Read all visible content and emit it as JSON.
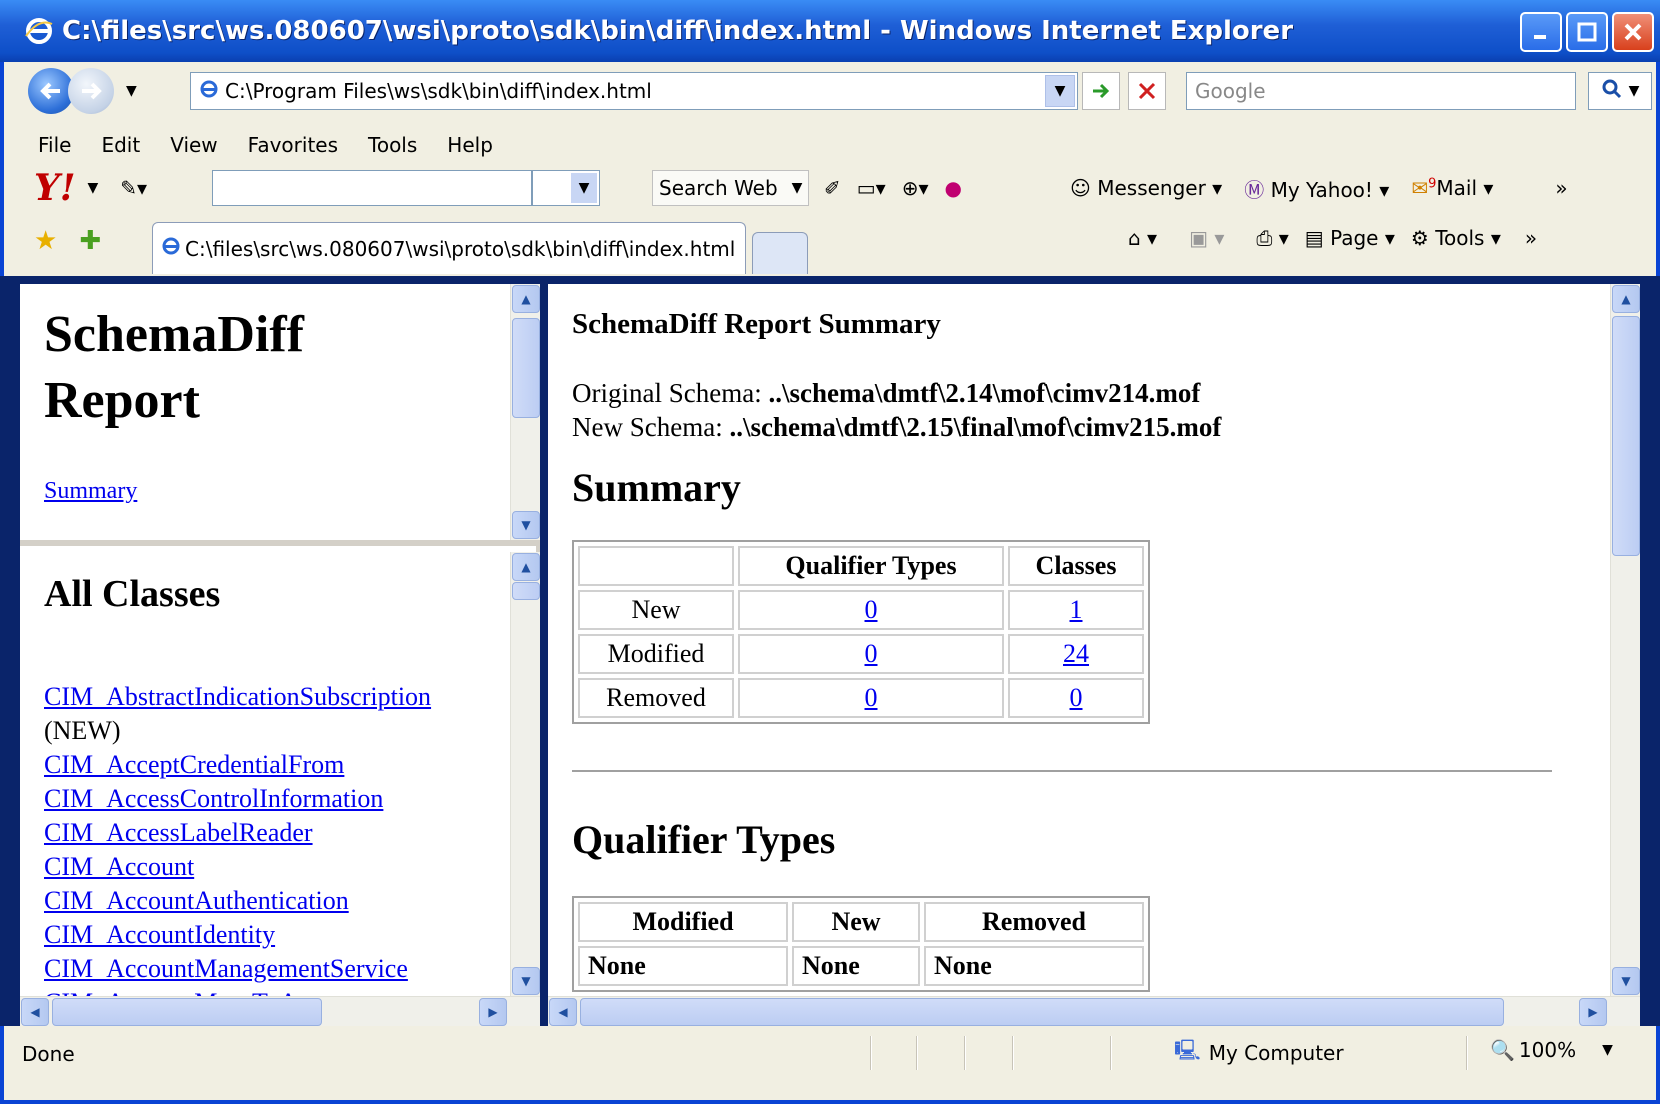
{
  "window": {
    "title": "C:\\files\\src\\ws.080607\\wsi\\proto\\sdk\\bin\\diff\\index.html - Windows Internet Explorer"
  },
  "address": {
    "url": "C:\\Program Files\\ws\\sdk\\bin\\diff\\index.html",
    "search_placeholder": "Google"
  },
  "menu": [
    "File",
    "Edit",
    "View",
    "Favorites",
    "Tools",
    "Help"
  ],
  "yahoo_toolbar": {
    "search_web": "Search Web",
    "messenger": "Messenger",
    "my_yahoo": "My Yahoo!",
    "mail": "Mail",
    "mail_count": "9"
  },
  "tab": {
    "title": "C:\\files\\src\\ws.080607\\wsi\\proto\\sdk\\bin\\diff\\index.html"
  },
  "command_bar": {
    "page": "Page",
    "tools": "Tools"
  },
  "nav_frame": {
    "heading_line1": "SchemaDiff",
    "heading_line2": "Report",
    "summary_link": "Summary"
  },
  "classes_frame": {
    "heading": "All Classes",
    "items": [
      {
        "name": "CIM_AbstractIndicationSubscription",
        "tag": "(NEW)"
      },
      {
        "name": "CIM_AcceptCredentialFrom"
      },
      {
        "name": "CIM_AccessControlInformation"
      },
      {
        "name": "CIM_AccessLabelReader"
      },
      {
        "name": "CIM_Account"
      },
      {
        "name": "CIM_AccountAuthentication"
      },
      {
        "name": "CIM_AccountIdentity"
      },
      {
        "name": "CIM_AccountManagementService"
      },
      {
        "name": "CIM_AccountMapsToAccount"
      }
    ]
  },
  "report": {
    "title": "SchemaDiff Report Summary",
    "original_label": "Original Schema: ",
    "original_path": "..\\schema\\dmtf\\2.14\\mof\\cimv214.mof",
    "new_label": "New Schema: ",
    "new_path": "..\\schema\\dmtf\\2.15\\final\\mof\\cimv215.mof",
    "summary_heading": "Summary",
    "summary_table": {
      "headers": [
        "",
        "Qualifier Types",
        "Classes"
      ],
      "rows": [
        {
          "label": "New",
          "qualifier_types": "0",
          "classes": "1"
        },
        {
          "label": "Modified",
          "qualifier_types": "0",
          "classes": "24"
        },
        {
          "label": "Removed",
          "qualifier_types": "0",
          "classes": "0"
        }
      ]
    },
    "qualifier_heading": "Qualifier Types",
    "qualifier_table": {
      "headers": [
        "Modified",
        "New",
        "Removed"
      ],
      "row": [
        "None",
        "None",
        "None"
      ]
    }
  },
  "status": {
    "text": "Done",
    "zone": "My Computer",
    "zoom": "100%"
  },
  "colors": {
    "titlebar": "#0e4fc8",
    "link": "#0000ee",
    "chrome": "#f1efe2"
  }
}
